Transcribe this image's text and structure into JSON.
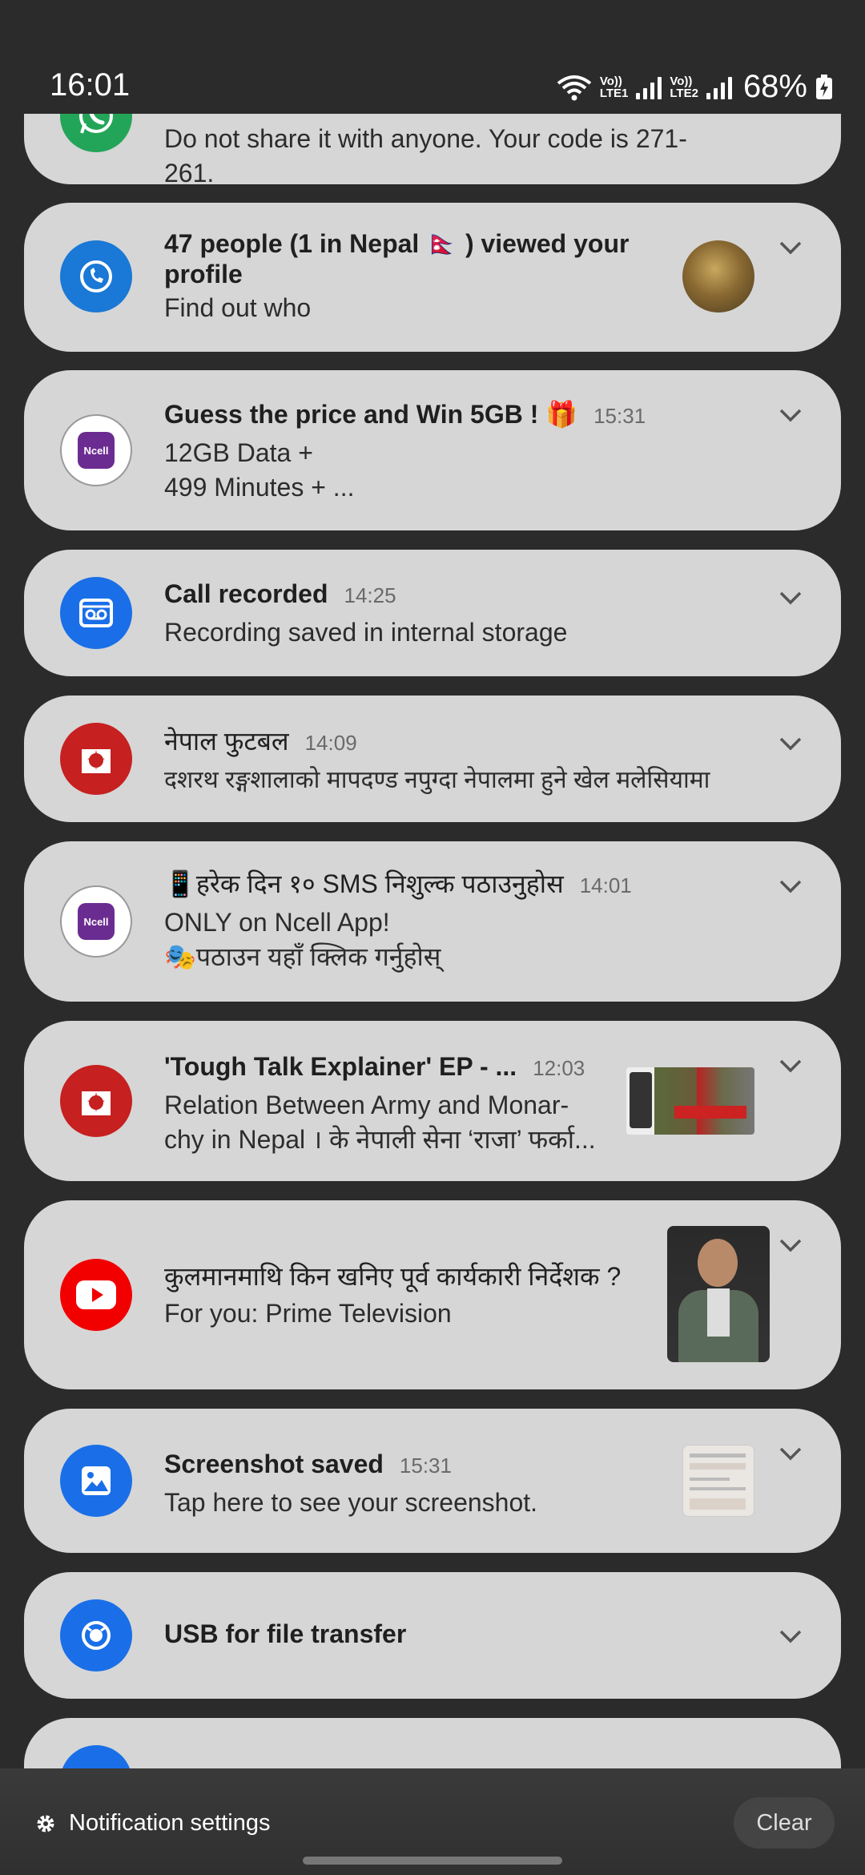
{
  "status_bar": {
    "time": "16:01",
    "lte1": "LTE1",
    "lte2": "LTE2",
    "volte": "Vo))",
    "battery": "68%"
  },
  "notifications": [
    {
      "app_icon": "whatsapp-icon",
      "body": "Do not share it with anyone. Your code is 271-261."
    },
    {
      "app_icon": "truecaller-icon",
      "title": "47 people (1 in Nepal 🇳🇵 ) viewed your profile",
      "body": "Find out who"
    },
    {
      "app_icon": "ncell-icon",
      "icon_text": "Ncell",
      "title": "Guess the price and Win 5GB ! 🎁",
      "time": "15:31",
      "body_line1": "12GB Data +",
      "body_line2": "499 Minutes + ..."
    },
    {
      "app_icon": "voice-recorder-icon",
      "title": "Call recorded",
      "time": "14:25",
      "body": "Recording saved in internal storage"
    },
    {
      "app_icon": "nepal-football-icon",
      "title": "नेपाल फुटबल",
      "time": "14:09",
      "body": "दशरथ रङ्गशालाको मापदण्ड नपुग्दा नेपालमा हुने खेल मलेसियामा"
    },
    {
      "app_icon": "ncell-icon",
      "icon_text": "Ncell",
      "title": "📱हरेक दिन १० SMS निशुल्क पठाउनुहोस",
      "time": "14:01",
      "body_line1": "ONLY on Ncell App!",
      "body_line2": "🎭पठाउन यहाँ क्लिक गर्नुहोस्"
    },
    {
      "app_icon": "news-app-icon",
      "title": "'Tough Talk Explainer' EP - ...",
      "time": "12:03",
      "body_line1": "Relation Between Army and Monar-",
      "body_line2": "chy in Nepal । के नेपाली सेना ‘राजा’ फर्का..."
    },
    {
      "app_icon": "youtube-icon",
      "title": "कुलमानमाथि किन खनिए पूर्व कार्यकारी निर्देशक ?",
      "body": "For you: Prime Television"
    },
    {
      "app_icon": "gallery-icon",
      "title": "Screenshot saved",
      "time": "15:31",
      "body": "Tap here to see your screenshot."
    },
    {
      "app_icon": "usb-icon",
      "title": "USB for file transfer"
    }
  ],
  "footer": {
    "settings_label": "Notification settings",
    "clear_label": "Clear"
  },
  "colors": {
    "card_bg": "#d6d6d6",
    "background": "#2b2b2b",
    "whatsapp": "#23a559",
    "blue_app": "#1a6fe8",
    "news_red": "#c62020",
    "youtube_red": "#f20000",
    "ncell_purple": "#6b2c91"
  }
}
